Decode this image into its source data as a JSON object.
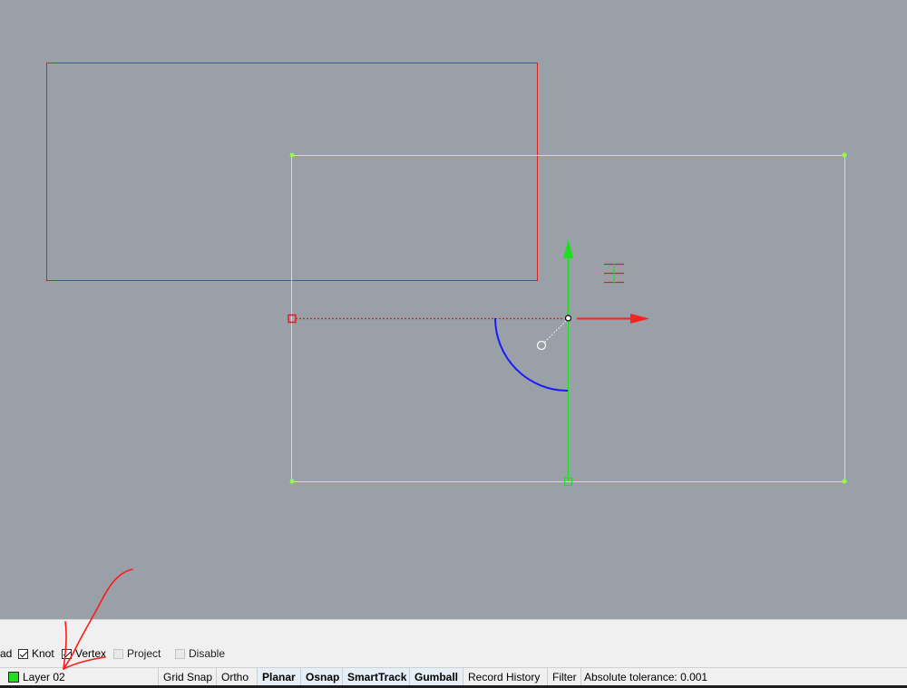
{
  "colors": {
    "viewport_bg": "#9aa0a8",
    "red_curve": "#e02020",
    "selected_curve": "#f0f020",
    "gumball_x": "#ff2020",
    "gumball_y": "#20dd20",
    "gumball_rotate": "#1a1aff",
    "layer_color": "#22dd22",
    "annotation": "#ff1a1a"
  },
  "gumball": {
    "x_axis_icon": "gumball-x-arrow-icon",
    "y_axis_icon": "gumball-y-arrow-icon",
    "rotate_icon": "gumball-rotate-arc-icon",
    "menu_icon": "gumball-menu-icon"
  },
  "osnap": {
    "items": [
      {
        "label": "ad",
        "checked": null
      },
      {
        "label": "Knot",
        "checked": true
      },
      {
        "label": "Vertex",
        "checked": true
      },
      {
        "label": "Project",
        "checked": false
      },
      {
        "label": "Disable",
        "checked": false
      }
    ]
  },
  "status": {
    "layer": "Layer 02",
    "grid_snap": "Grid Snap",
    "ortho": "Ortho",
    "planar": "Planar",
    "osnap": "Osnap",
    "smarttrack": "SmartTrack",
    "gumball": "Gumball",
    "record_history": "Record History",
    "filter": "Filter",
    "tolerance": "Absolute tolerance: 0.001"
  }
}
